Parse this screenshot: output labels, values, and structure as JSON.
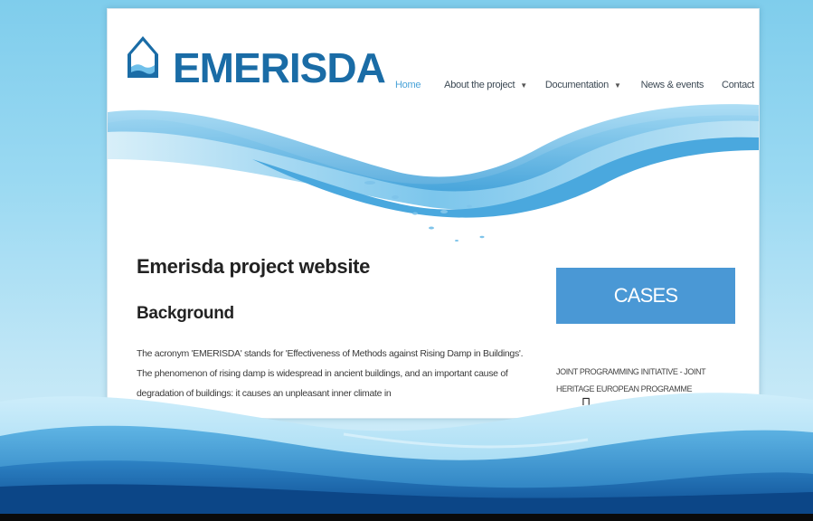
{
  "site": {
    "logo_text": "EMERISDA",
    "nav": {
      "home": "Home",
      "about": "About the project",
      "documentation": "Documentation",
      "news": "News & events",
      "contact": "Contact"
    },
    "title": "Emerisda project website",
    "subtitle": "Background",
    "body_text": "The acronym 'EMERISDA' stands for 'Effectiveness of Methods against Rising Damp in Buildings'. The phenomenon of rising damp is widespread in ancient buildings, and an important cause of degradation of buildings: it causes an unpleasant inner climate in",
    "sidebar": {
      "cases_label": "CASES",
      "link_text": "JOINT PROGRAMMING INITIATIVE - JOINT HERITAGE EUROPEAN PROGRAMME"
    }
  },
  "icons": [
    "emerisda-logo-icon",
    "caret-down-icon",
    "water-wave-graphic",
    "water-splash-graphic"
  ],
  "colors": {
    "brand_blue": "#1a6ca6",
    "cases_button": "#4a98d5",
    "nav_active": "#4aa3d8",
    "backdrop": "#8fd3ef"
  }
}
